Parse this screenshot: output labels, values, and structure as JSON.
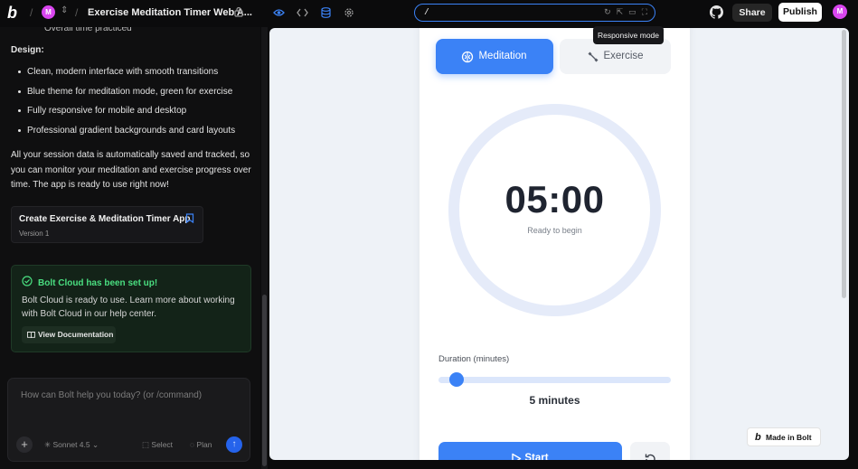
{
  "topbar": {
    "logo": "b",
    "avatar_initial": "M",
    "project_title": "Exercise Meditation Timer Web A...",
    "url_value": "/",
    "share_label": "Share",
    "publish_label": "Publish",
    "user_initial": "M"
  },
  "tooltip": "Responsive mode",
  "chat": {
    "faded_line": "Overall time practiced",
    "design_heading": "Design:",
    "bullets": [
      "Clean, modern interface with smooth transitions",
      "Blue theme for meditation mode, green for exercise",
      "Fully responsive for mobile and desktop",
      "Professional gradient backgrounds and card layouts"
    ],
    "paragraph": "All your session data is automatically saved and tracked, so you can monitor your meditation and exercise progress over time. The app is ready to use right now!",
    "version_card": {
      "title": "Create Exercise & Meditation Timer App",
      "version": "Version 1"
    },
    "cloud": {
      "title": "Bolt Cloud has been set up!",
      "text": "Bolt Cloud is ready to use. Learn more about working with Bolt Cloud in our help center.",
      "button": "View Documentation"
    }
  },
  "prompt": {
    "placeholder": "How can Bolt help you today? (or /command)",
    "model": "Sonnet 4.5",
    "select_label": "Select",
    "plan_label": "Plan"
  },
  "app": {
    "tab_meditation": "Meditation",
    "tab_exercise": "Exercise",
    "time": "05:00",
    "status": "Ready to begin",
    "duration_label": "Duration (minutes)",
    "duration_value": "5 minutes",
    "duration_fraction": 0.05,
    "start_label": "Start"
  },
  "badge": {
    "made_in": "Made in Bolt"
  },
  "colors": {
    "accent": "#3b82f6",
    "cloud_green": "#4ade80",
    "avatar": "#d946ef"
  }
}
